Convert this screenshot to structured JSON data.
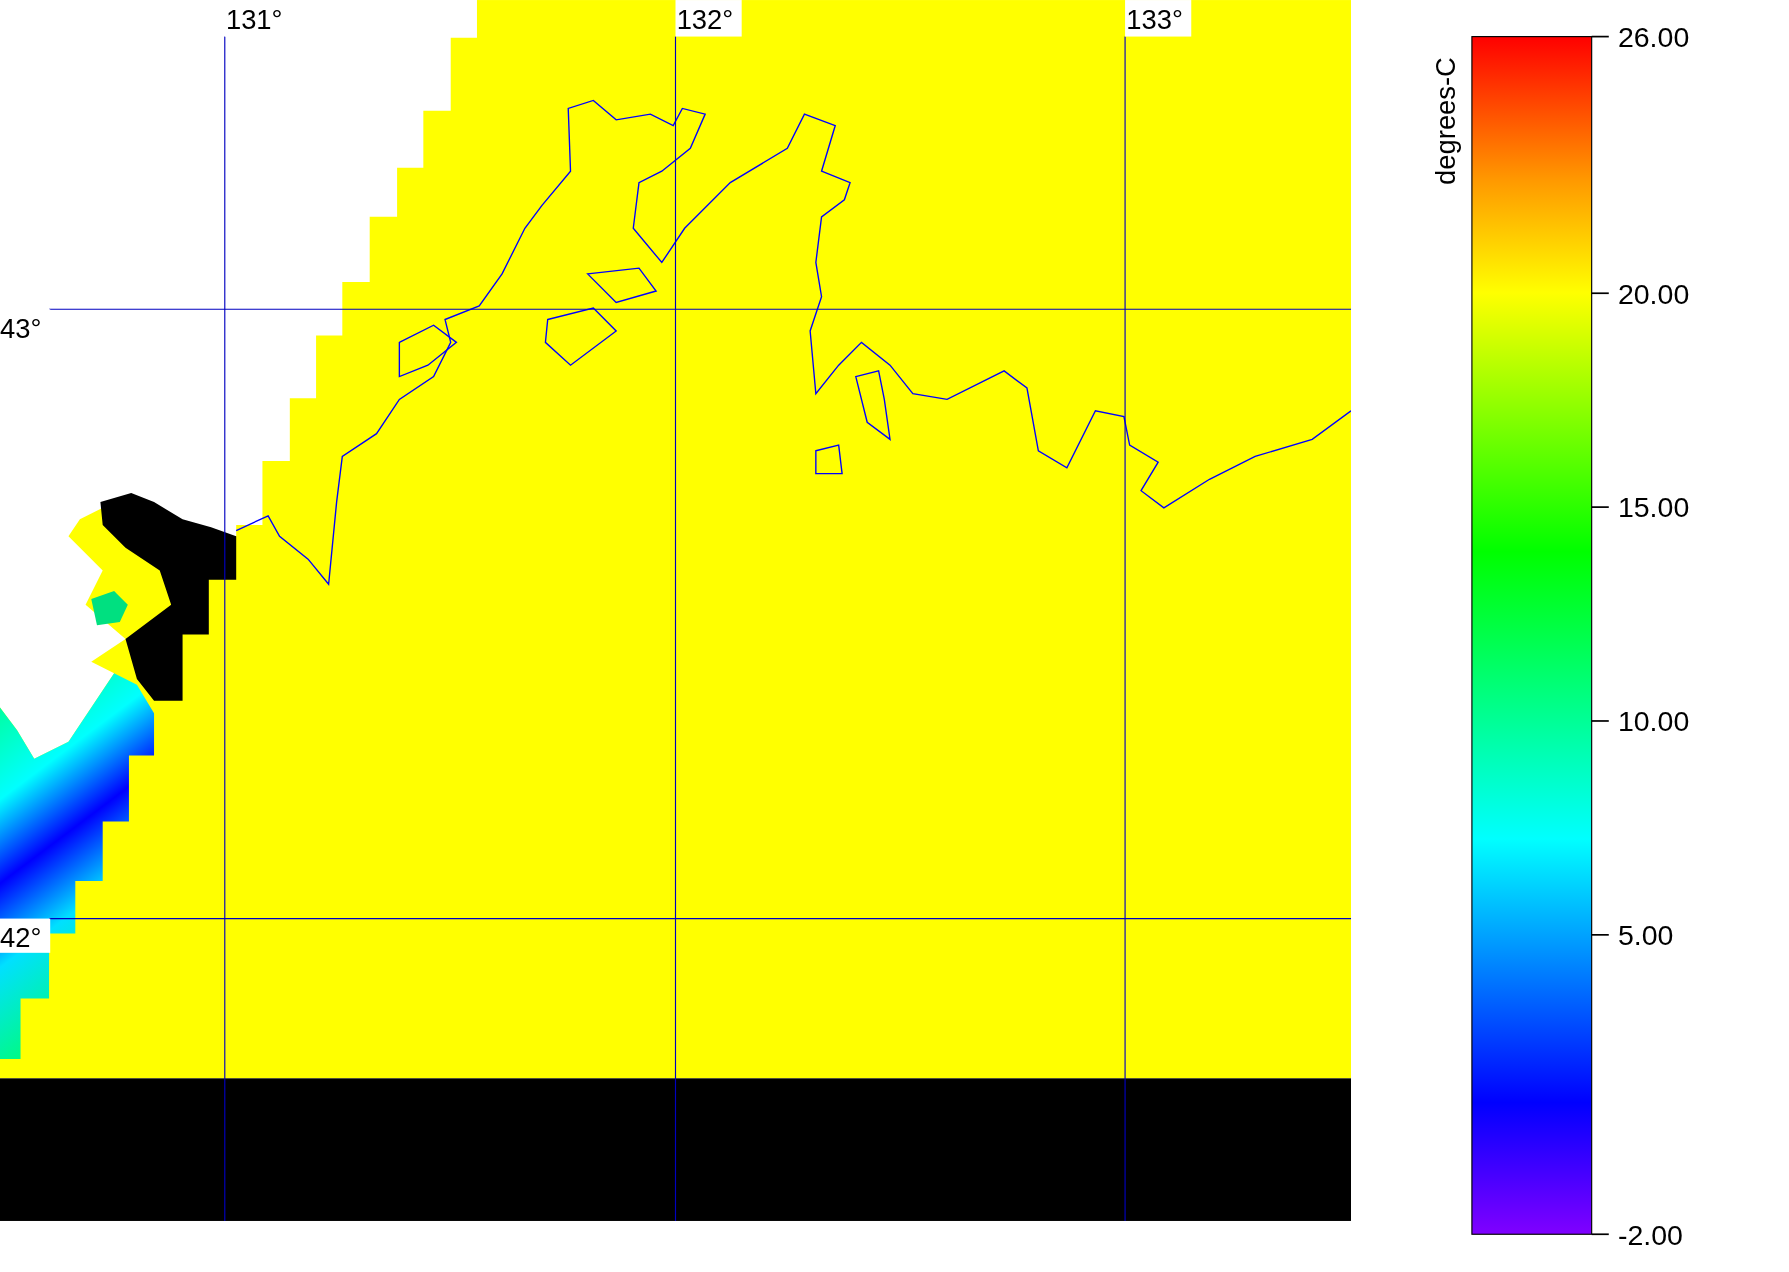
{
  "map": {
    "longitude_labels": [
      "131°",
      "132°",
      "133°"
    ],
    "latitude_labels": [
      "43°",
      "42°"
    ]
  },
  "color_scale": {
    "title": "degrees-C",
    "ticks": [
      "26.00",
      "20.00",
      "15.00",
      "10.00",
      "5.00",
      "-2.00"
    ]
  }
}
